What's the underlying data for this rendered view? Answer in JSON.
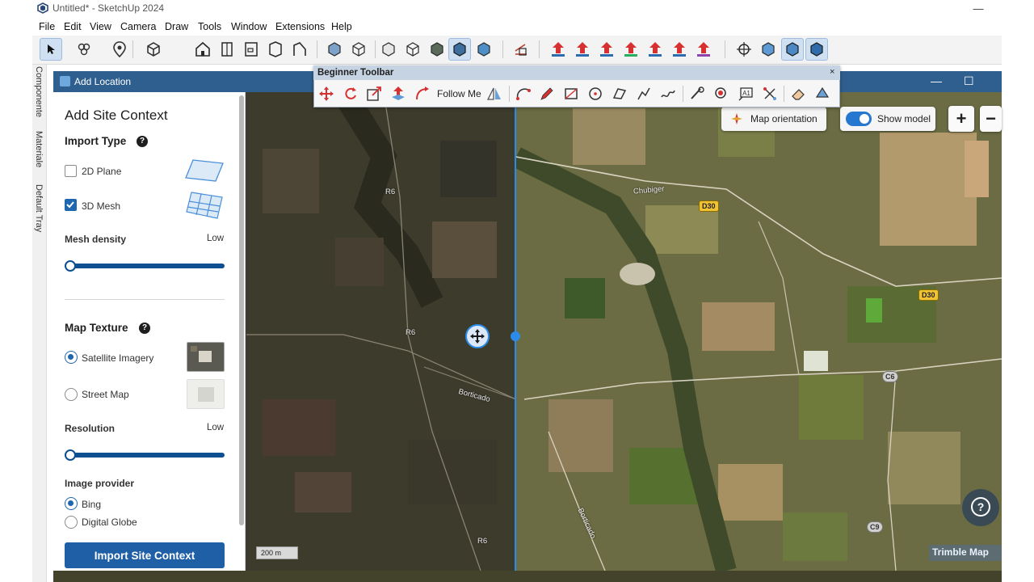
{
  "window": {
    "title": "Untitled* - SketchUp 2024",
    "controls": [
      "—",
      "☐",
      "✕"
    ]
  },
  "menu": [
    "File",
    "Edit",
    "View",
    "Camera",
    "Draw",
    "Tools",
    "Window",
    "Extensions",
    "Help"
  ],
  "main_toolbar": {
    "icons": [
      "select-icon",
      "component-icon",
      "location-pin-icon",
      "box-icon",
      "house-icon",
      "door-icon",
      "panel-icon",
      "plane-icon",
      "wall-icon",
      "shaded-box-icon",
      "wireframe-box-icon",
      "section-icon",
      "iso-box-icon",
      "solid-box-icon",
      "xray-box-icon",
      "textured-box-icon",
      "measure-icon",
      "arrow-red-icon",
      "arrow-j-icon",
      "arrow-r-icon",
      "arrow-v-icon",
      "arrow-n-icon",
      "arrow-x-icon",
      "arrow-f-icon",
      "orbit-icon",
      "cube-blue-icon",
      "cube-selected-icon",
      "cube-export-icon"
    ]
  },
  "left_tray": {
    "tabs": [
      "Componente",
      "Materiale",
      "Default Tray"
    ]
  },
  "add_location": {
    "title": "Add Location",
    "panel": {
      "heading": "Add Site Context",
      "import_type": {
        "label": "Import Type",
        "options": [
          {
            "label": "2D Plane",
            "checked": false
          },
          {
            "label": "3D Mesh",
            "checked": true
          }
        ]
      },
      "mesh_density": {
        "label": "Mesh density",
        "value": "Low",
        "level": 0
      },
      "map_texture": {
        "label": "Map Texture",
        "options": [
          {
            "label": "Satellite Imagery",
            "selected": true
          },
          {
            "label": "Street Map",
            "selected": false
          }
        ]
      },
      "resolution": {
        "label": "Resolution",
        "value": "Low",
        "level": 0
      },
      "image_provider": {
        "label": "Image provider",
        "options": [
          {
            "label": "Bing",
            "selected": true
          },
          {
            "label": "Digital Globe",
            "selected": false
          }
        ]
      },
      "import_button": "Import Site Context"
    },
    "map": {
      "map_orientation": "Map orientation",
      "show_model": "Show model",
      "show_model_on": true,
      "zoom_in": "+",
      "zoom_out": "−",
      "scale": "200 m",
      "attribution": "Trimble Map",
      "road_labels": {
        "r6_top": "R6",
        "r6_mid": "R6",
        "r6_bottom": "R6",
        "chubiger": "Chubiger",
        "d30_top": "D30",
        "d30_right": "D30",
        "c6": "C6",
        "c9": "C9",
        "borticado_left": "Borticado",
        "borticado_right": "Borticado"
      }
    }
  },
  "beginner_toolbar": {
    "title": "Beginner Toolbar",
    "follow_me": "Follow Me",
    "close": "×"
  },
  "colors": {
    "accent": "#1f5fa6",
    "split_line": "#2b8be8",
    "toggle_on": "#2577d0"
  }
}
